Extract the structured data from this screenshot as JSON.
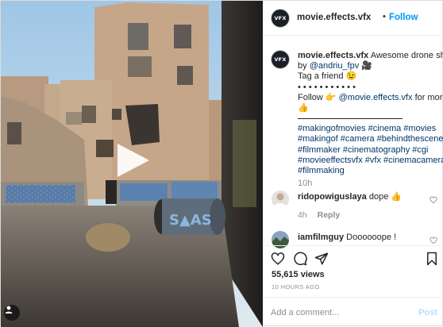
{
  "post": {
    "username": "movie.effects.vfx",
    "separator": "•",
    "follow_label": "Follow",
    "avatar_text": "VFX"
  },
  "caption": {
    "username": "movie.effects.vfx",
    "text_1": "Awesome drone shot",
    "by": "by",
    "mention_author": "@andriu_fpv",
    "camera_emoji": "🎥",
    "tag_friend": "Tag a friend 😉",
    "dots": "• • • • • • • • • • •",
    "follow_prefix": "Follow 👉",
    "follow_mention": "@movie.effects.vfx",
    "follow_suffix": "for more",
    "thumb": "👍",
    "hashtags": [
      "#makingofmovies #cinema #movies",
      "#makingof #camera #behindthescenes",
      "#filmmaker #cinematography #cgi",
      "#movieeffectsvfx #vfx #cinemacamera",
      "#filmmaking"
    ],
    "time": "10h"
  },
  "comments": [
    {
      "username": "ridopowiguslaya",
      "text": "dope 👍",
      "time": "4h",
      "reply_label": "Reply"
    },
    {
      "username": "iamfilmguy",
      "text": "Doooooope !"
    }
  ],
  "stats": {
    "views": "55,615 views",
    "posted": "10 HOURS AGO"
  },
  "composer": {
    "placeholder": "Add a comment...",
    "post_label": "Post"
  },
  "icons": {
    "play": "play-icon",
    "user_tag": "user-tag-icon",
    "like": "heart-icon",
    "comment": "comment-icon",
    "share": "share-icon",
    "save": "bookmark-icon"
  }
}
